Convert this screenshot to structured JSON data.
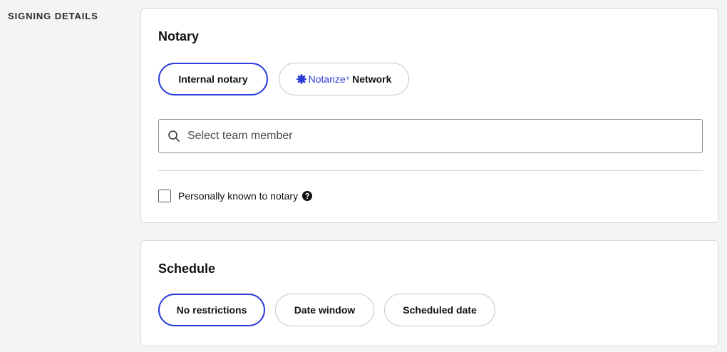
{
  "section": {
    "label": "SIGNING DETAILS"
  },
  "notary": {
    "title": "Notary",
    "options": {
      "internal": "Internal notary",
      "network_brand": "Notarize",
      "network_brand_mark": "®",
      "network_label": "Network"
    },
    "selected": "internal",
    "search": {
      "placeholder": "Select team member",
      "value": "",
      "icon": "search-icon"
    },
    "personally_known": {
      "label": "Personally known to notary",
      "checked": false,
      "help_icon": "question-circle-icon"
    }
  },
  "schedule": {
    "title": "Schedule",
    "options": {
      "none": "No restrictions",
      "window": "Date window",
      "scheduled": "Scheduled date"
    },
    "selected": "none"
  },
  "colors": {
    "accent": "#2c3dd8",
    "background": "#f4f4f5",
    "card": "#ffffff",
    "border": "#d9d9dc"
  }
}
